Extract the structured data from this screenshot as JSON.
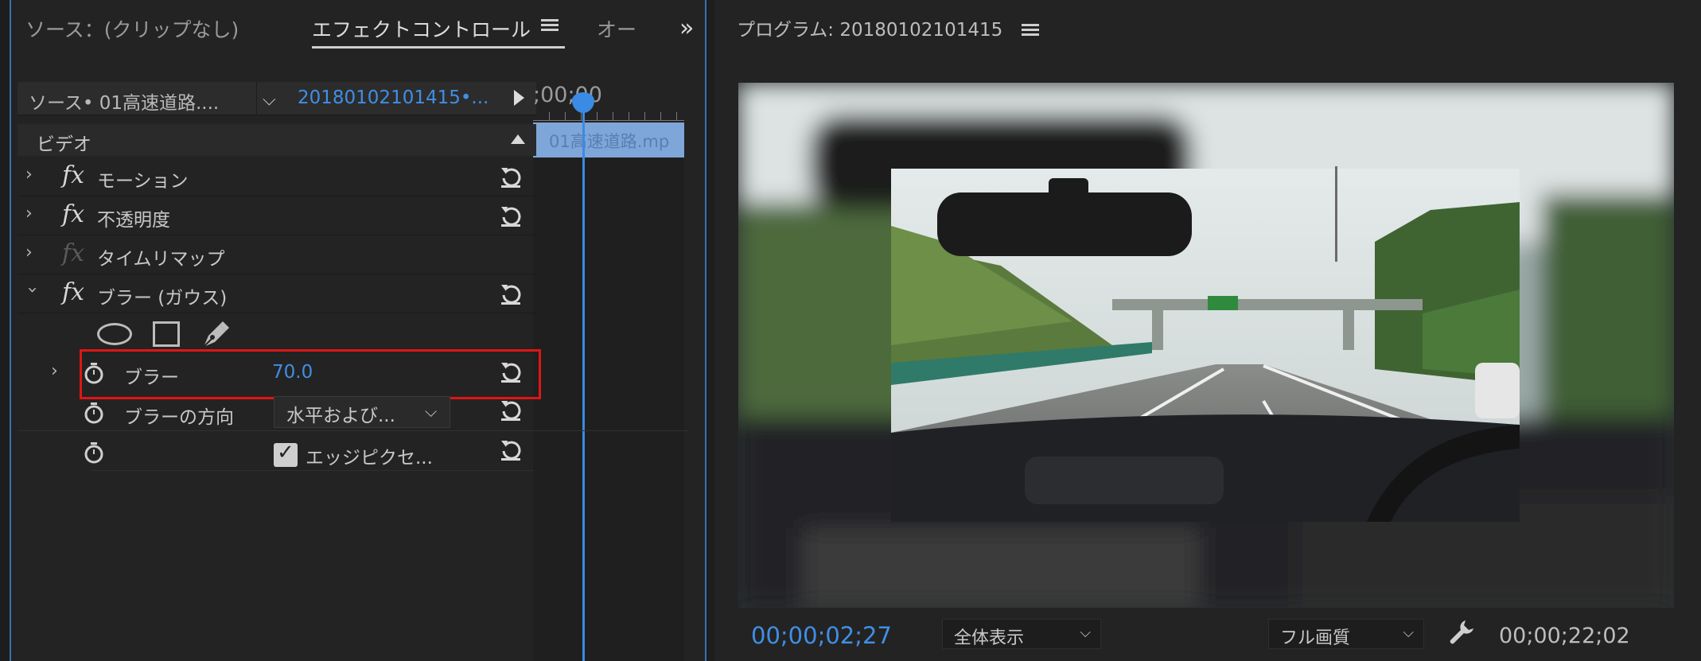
{
  "left_panel": {
    "tabs": {
      "source": "ソース：(クリップなし)",
      "effect_controls": "エフェクトコントロール",
      "audio": "オー",
      "overflow": "»"
    },
    "source_row": {
      "source_clip": "ソース• 01高速道路....",
      "sequence": "20180102101415•..."
    },
    "timeline": {
      "timecode": ";00;00",
      "clip_label": "01高速道路.mp"
    },
    "video_header": "ビデオ",
    "effects": [
      {
        "name": "モーション",
        "enabled": true
      },
      {
        "name": "不透明度",
        "enabled": true
      },
      {
        "name": "タイムリマップ",
        "enabled": false
      },
      {
        "name": "ブラー (ガウス)",
        "enabled": true
      }
    ],
    "params": {
      "blur_label": "ブラー",
      "blur_value": "70.0",
      "direction_label": "ブラーの方向",
      "direction_value": "水平および...",
      "edge_label": "エッジピクセ...",
      "edge_checked": true
    }
  },
  "program": {
    "title": "プログラム: 20180102101415",
    "current_timecode": "00;00;02;27",
    "zoom": "全体表示",
    "quality": "フル画質",
    "duration": "00;00;22;02"
  },
  "colors": {
    "accent": "#3f8fe6",
    "highlight_box": "#e01515",
    "panel": "#232323"
  }
}
